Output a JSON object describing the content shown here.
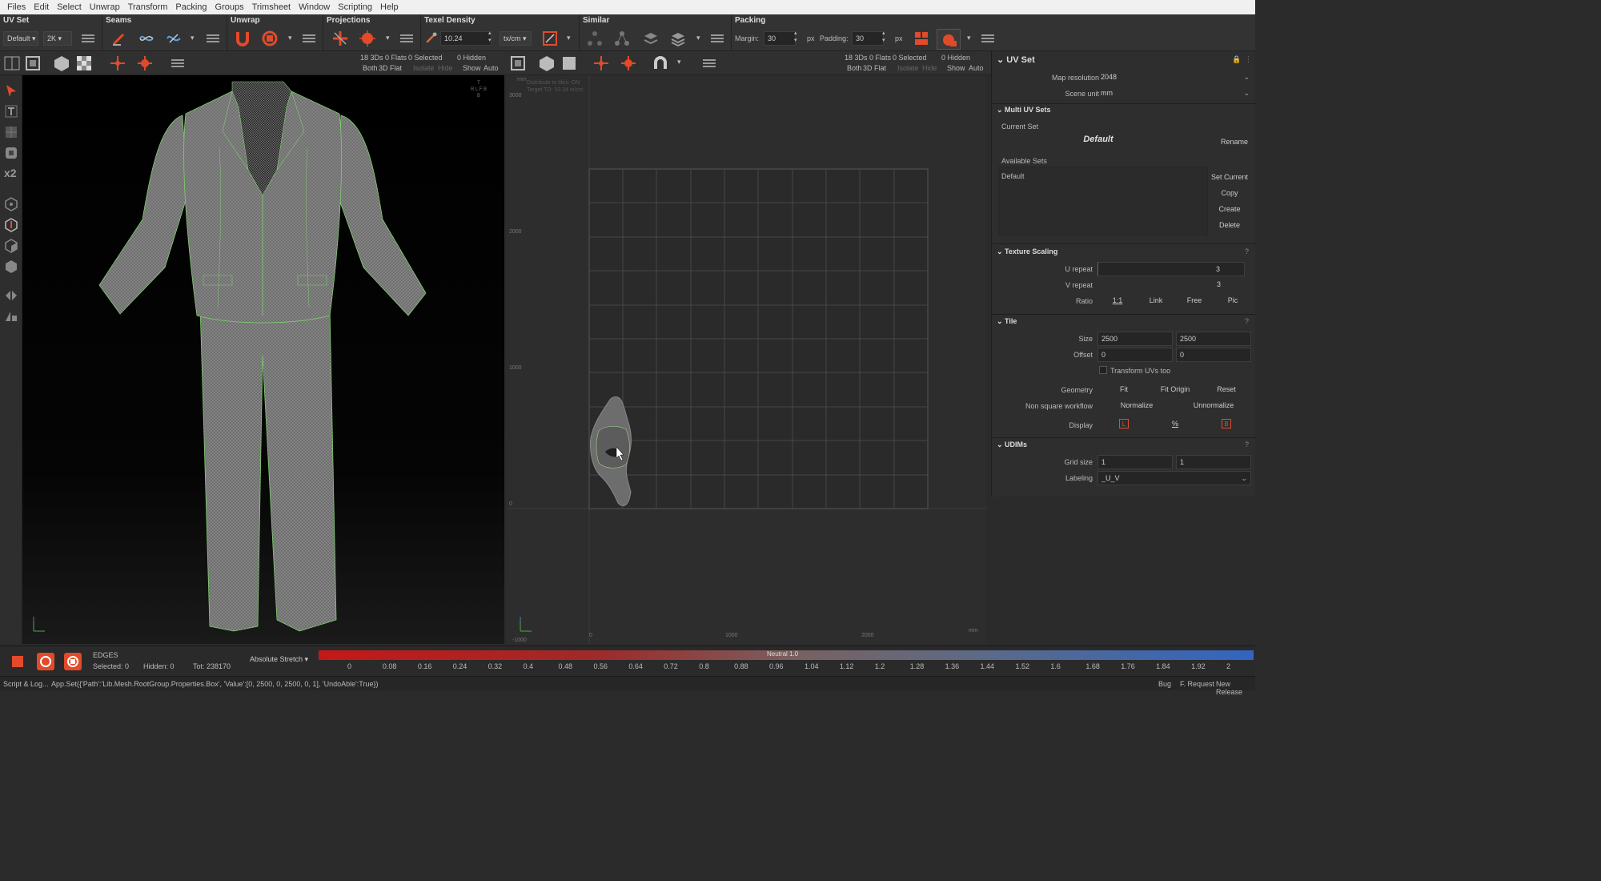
{
  "menu": [
    "Files",
    "Edit",
    "Select",
    "Unwrap",
    "Transform",
    "Packing",
    "Groups",
    "Trimsheet",
    "Window",
    "Scripting",
    "Help"
  ],
  "toolbar": {
    "sections": [
      "UV Set",
      "Seams",
      "Unwrap",
      "Projections",
      "Texel Density",
      "Similar",
      "Packing"
    ],
    "uvset_dropdown": "Default",
    "resolution_dropdown": "2K",
    "texel_value": "10.24",
    "texel_unit": "tx/cm",
    "margin_label": "Margin:",
    "margin_value": "30",
    "margin_unit": "px",
    "padding_label": "Padding:",
    "padding_value": "30",
    "padding_unit": "px"
  },
  "viewport3d": {
    "stats": "18 3Ds 0 Flats",
    "selected": "0 Selected",
    "hidden": "0 Hidden",
    "row2": [
      "Both",
      "3D",
      "Flat",
      "Isolate",
      "Hide",
      "Show",
      "Auto"
    ]
  },
  "viewportuv": {
    "stats": "18 3Ds 0 Flats",
    "selected": "0 Selected",
    "hidden": "0 Hidden",
    "row2": [
      "Both",
      "3D",
      "Flat",
      "Isolate",
      "Hide",
      "Show",
      "Auto"
    ],
    "info1": "Distribute to tiles: ON",
    "info2": "Target TD: 10.24 tx/cm",
    "unit": "mm",
    "y_ticks": [
      "3000",
      "2000",
      "1000",
      "0",
      "-1000"
    ],
    "x_ticks": [
      "0",
      "1000",
      "2000"
    ],
    "x_unit": "mm"
  },
  "panel": {
    "title": "UV Set",
    "map_resolution_label": "Map resolution",
    "map_resolution": "2048",
    "scene_unit_label": "Scene unit",
    "scene_unit": "mm",
    "multi_title": "Multi UV Sets",
    "current_set_label": "Current Set",
    "current_set": "Default",
    "rename": "Rename",
    "available_label": "Available Sets",
    "available_item": "Default",
    "set_current": "Set Current",
    "copy": "Copy",
    "create": "Create",
    "delete": "Delete",
    "texture_title": "Texture Scaling",
    "u_repeat_label": "U repeat",
    "u_repeat": "3",
    "v_repeat_label": "V repeat",
    "v_repeat": "3",
    "ratio_label": "Ratio",
    "ratio_opts": [
      "1:1",
      "Link",
      "Free",
      "Pic"
    ],
    "tile_title": "Tile",
    "size_label": "Size",
    "size_u": "2500",
    "size_v": "2500",
    "offset_label": "Offset",
    "offset_u": "0",
    "offset_v": "0",
    "transform_uvs": "Transform UVs too",
    "geometry_label": "Geometry",
    "geometry_btns": [
      "Fit",
      "Fit Origin",
      "Reset"
    ],
    "nonsquare_label": "Non square workflow",
    "nonsquare_btns": [
      "Normalize",
      "Unnormalize"
    ],
    "display_label": "Display",
    "display_btns": [
      "L",
      "%",
      "B"
    ],
    "udims_title": "UDIMs",
    "grid_label": "Grid size",
    "grid_u": "1",
    "grid_v": "1",
    "labeling_label": "Labeling",
    "labeling": "_U_V"
  },
  "bottom": {
    "mode": "EDGES",
    "selected": "Selected: 0",
    "hidden": "Hidden: 0",
    "total": "Tot: 238170",
    "stretch_mode": "Absolute Stretch",
    "neutral": "Neutral 1.0",
    "scale": [
      "0",
      "0.08",
      "0.16",
      "0.24",
      "0.32",
      "0.4",
      "0.48",
      "0.56",
      "0.64",
      "0.72",
      "0.8",
      "0.88",
      "0.96",
      "1.04",
      "1.12",
      "1.2",
      "1.28",
      "1.36",
      "1.44",
      "1.52",
      "1.6",
      "1.68",
      "1.76",
      "1.84",
      "1.92",
      "2"
    ]
  },
  "status": {
    "script_log": "Script & Log...",
    "command": "App.Set({'Path':'Lib.Mesh.RootGroup.Properties.Box', 'Value':[0, 2500, 0, 2500, 0, 1], 'UndoAble':True})",
    "links": [
      "Bug",
      "F. Request",
      "New Release"
    ]
  }
}
